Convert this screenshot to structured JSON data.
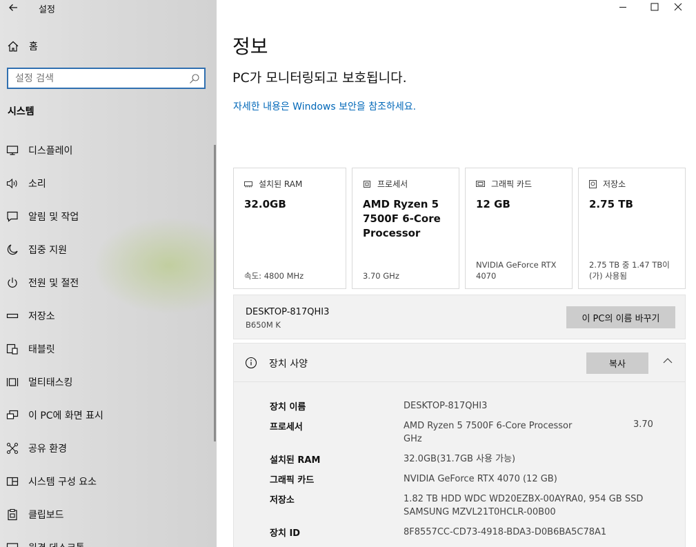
{
  "app": {
    "title": "설정"
  },
  "window": {
    "controls": [
      "minimize",
      "maximize",
      "close"
    ]
  },
  "sidebar": {
    "home_label": "홈",
    "search_placeholder": "설정 검색",
    "section_title": "시스템",
    "items": [
      {
        "label": "디스플레이",
        "icon": "monitor-icon"
      },
      {
        "label": "소리",
        "icon": "speaker-icon"
      },
      {
        "label": "알림 및 작업",
        "icon": "notification-icon"
      },
      {
        "label": "집중 지원",
        "icon": "moon-icon"
      },
      {
        "label": "전원 및 절전",
        "icon": "power-icon"
      },
      {
        "label": "저장소",
        "icon": "storage-icon"
      },
      {
        "label": "태블릿",
        "icon": "tablet-icon"
      },
      {
        "label": "멀티태스킹",
        "icon": "multitasking-icon"
      },
      {
        "label": "이 PC에 화면 표시",
        "icon": "project-icon"
      },
      {
        "label": "공유 환경",
        "icon": "share-icon"
      },
      {
        "label": "시스템 구성 요소",
        "icon": "components-icon"
      },
      {
        "label": "클립보드",
        "icon": "clipboard-icon"
      },
      {
        "label": "원격 데스크톱",
        "icon": "remote-desktop-icon"
      }
    ]
  },
  "main": {
    "title": "정보",
    "protection_status": "PC가 모니터링되고 보호됩니다.",
    "security_link": "자세한 내용은 Windows 보안을 참조하세요.",
    "cards": [
      {
        "label": "설치된 RAM",
        "value": "32.0GB",
        "sub": "속도: 4800 MHz",
        "icon": "ram-icon"
      },
      {
        "label": "프로세서",
        "value": "AMD Ryzen 5 7500F 6-Core Processor",
        "sub": "3.70 GHz",
        "icon": "cpu-icon"
      },
      {
        "label": "그래픽 카드",
        "value": "12 GB",
        "sub": "NVIDIA GeForce RTX 4070",
        "icon": "gpu-icon"
      },
      {
        "label": "저장소",
        "value": "2.75 TB",
        "sub": "2.75 TB 중 1.47 TB이(가) 사용됨",
        "icon": "disk-icon"
      }
    ],
    "device_panel": {
      "device_name": "DESKTOP-817QHI3",
      "motherboard": "B650M K",
      "rename_button": "이 PC의 이름 바꾸기"
    },
    "spec_panel": {
      "title": "장치 사양",
      "copy_button": "복사",
      "rows": [
        {
          "key": "장치 이름",
          "value": "DESKTOP-817QHI3"
        },
        {
          "key": "프로세서",
          "value": "AMD Ryzen 5 7500F 6-Core Processor GHz",
          "value_extra": "3.70"
        },
        {
          "key": "설치된 RAM",
          "value": "32.0GB(31.7GB 사용 가능)"
        },
        {
          "key": "그래픽 카드",
          "value": "NVIDIA GeForce RTX 4070 (12 GB)"
        },
        {
          "key": "저장소",
          "value": "1.82 TB HDD WDC WD20EZBX-00AYRA0, 954 GB SSD SAMSUNG MZVL21T0HCLR-00B00"
        },
        {
          "key": "장치 ID",
          "value": "8F8557CC-CD73-4918-BDA3-D0B6BA5C78A1"
        }
      ]
    }
  }
}
